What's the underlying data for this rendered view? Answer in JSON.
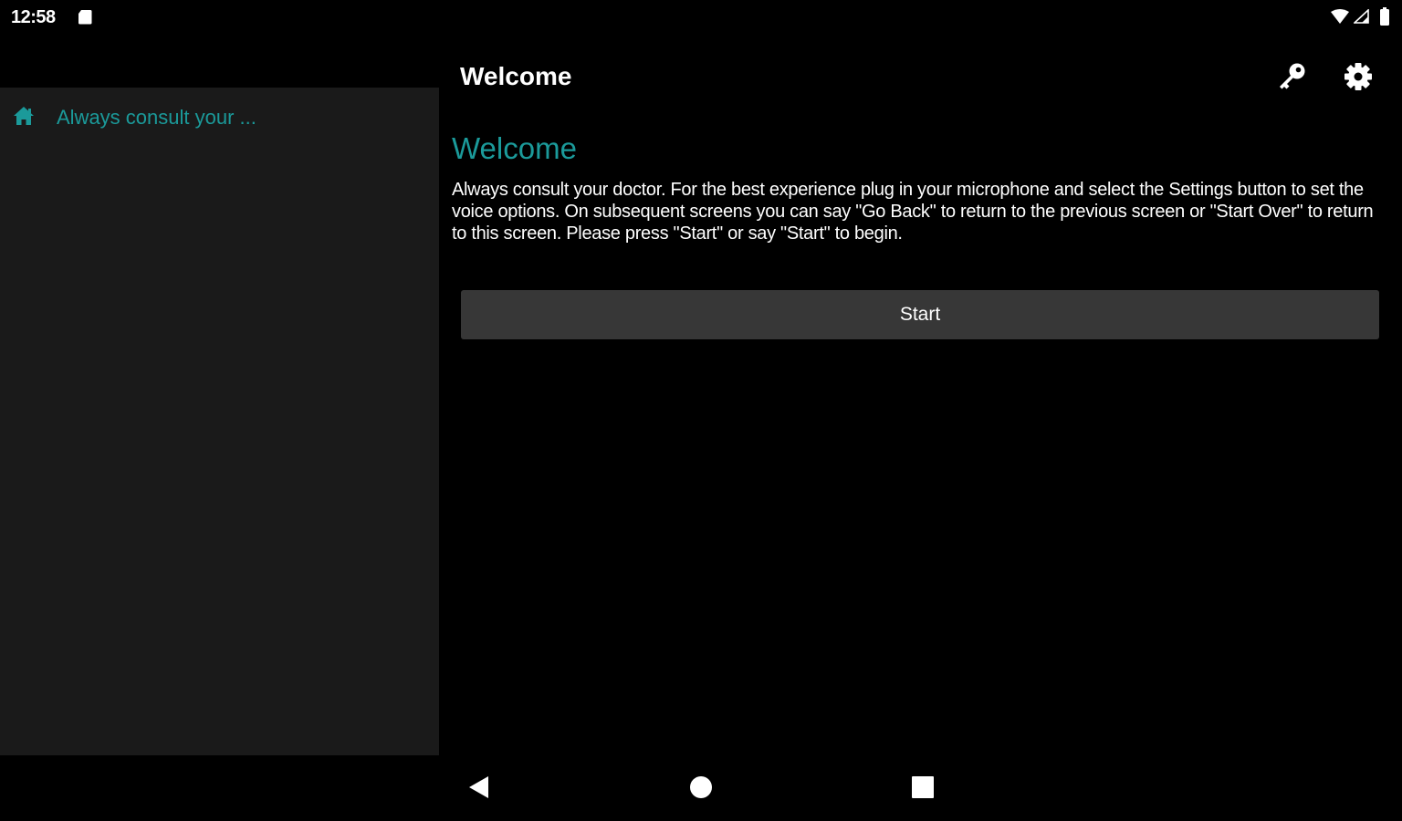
{
  "status_bar": {
    "time": "12:58",
    "icons": [
      "sd-card-icon",
      "wifi-icon",
      "signal-icon",
      "battery-icon"
    ]
  },
  "toolbar": {
    "title": "Welcome",
    "actions": [
      "key-icon",
      "gear-icon"
    ]
  },
  "sidebar": {
    "items": [
      {
        "icon": "home-icon",
        "label": "Always consult your ..."
      }
    ]
  },
  "main": {
    "heading": "Welcome",
    "body": "Always consult your doctor.  For the best experience plug in your microphone and select the Settings button to set the voice options.  On subsequent screens you can say \"Go Back\"  to return to the previous screen or \"Start Over\" to return to this screen.  Please press \"Start\" or say \"Start\" to begin.",
    "start_button_label": "Start"
  },
  "nav_bar": {
    "buttons": [
      "back-icon",
      "home-circle-icon",
      "recents-icon"
    ]
  },
  "colors": {
    "accent": "#1b9a9a",
    "background": "#000000",
    "sidebar_background": "#1a1a1a",
    "button_background": "#373737",
    "text": "#ffffff"
  }
}
